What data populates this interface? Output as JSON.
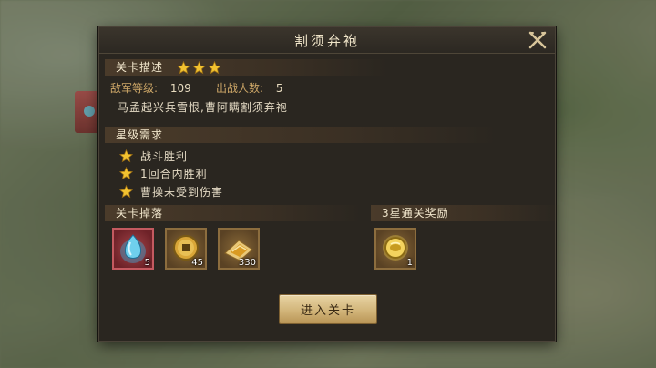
{
  "dialog": {
    "title": "割须弃袍"
  },
  "stage_info": {
    "header": "关卡描述",
    "stars": 3,
    "enemy_level_label": "敌军等级:",
    "enemy_level_value": "109",
    "troop_count_label": "出战人数:",
    "troop_count_value": "5",
    "description": "马孟起兴兵雪恨,曹阿瞒割须弃袍"
  },
  "star_requirements": {
    "header": "星级需求",
    "items": [
      "战斗胜利",
      "1回合内胜利",
      "曹操未受到伤害"
    ]
  },
  "drops": {
    "header": "关卡掉落",
    "items": [
      {
        "icon": "blue-crystal-icon",
        "qty": "5"
      },
      {
        "icon": "copper-coin-icon",
        "qty": "45"
      },
      {
        "icon": "supply-bundle-icon",
        "qty": "330"
      }
    ]
  },
  "clear_reward": {
    "header": "3星通关奖励",
    "items": [
      {
        "icon": "gold-coin-icon",
        "qty": "1"
      }
    ]
  },
  "actions": {
    "enter_label": "进入关卡"
  },
  "colors": {
    "panel_bg": "#2a2620",
    "header_bg": "#4a3b2a",
    "star_gold": "#f2c230",
    "button_gold": "#d2b57a",
    "label_tan": "#cfa868"
  }
}
